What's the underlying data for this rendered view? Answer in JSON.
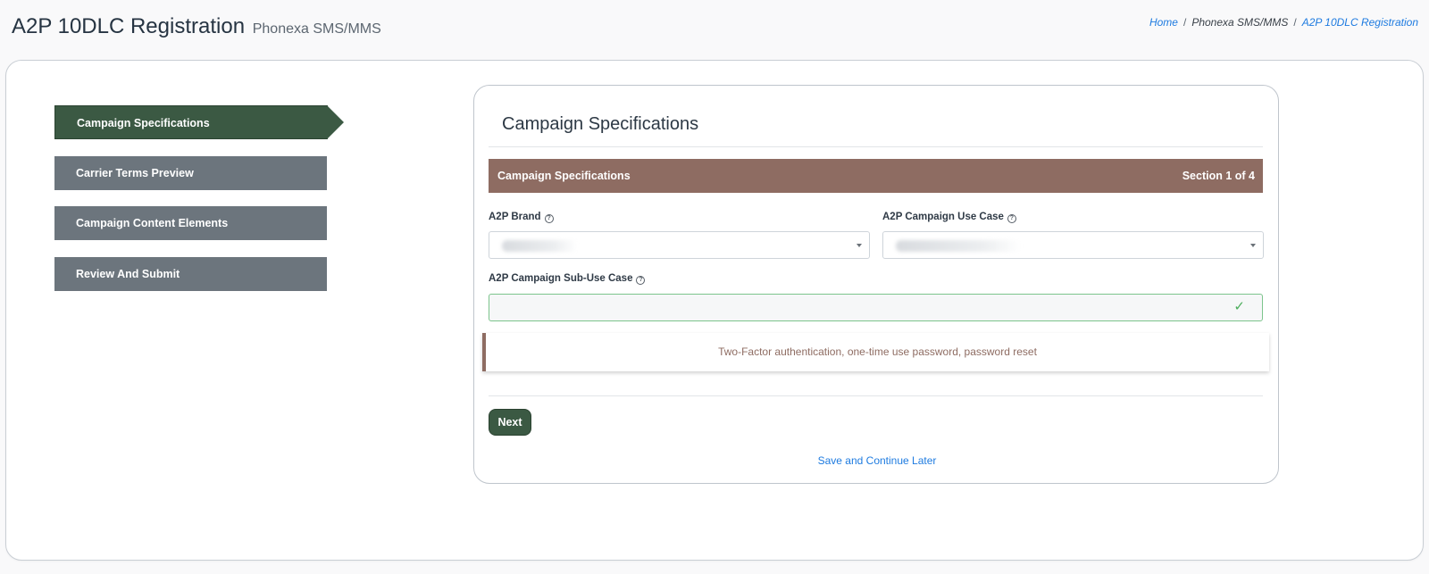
{
  "header": {
    "title": "A2P 10DLC Registration",
    "subtitle": "Phonexa SMS/MMS"
  },
  "breadcrumb": {
    "items": [
      "Home",
      "Phonexa SMS/MMS",
      "A2P 10DLC Registration"
    ],
    "separator": "/"
  },
  "steps": [
    {
      "label": "Campaign Specifications",
      "active": true
    },
    {
      "label": "Carrier Terms Preview",
      "active": false
    },
    {
      "label": "Campaign Content Elements",
      "active": false
    },
    {
      "label": "Review And Submit",
      "active": false
    }
  ],
  "form": {
    "title": "Campaign Specifications",
    "section": {
      "name": "Campaign Specifications",
      "progress": "Section 1 of 4"
    },
    "fields": {
      "brand_label": "A2P Brand",
      "use_case_label": "A2P Campaign Use Case",
      "sub_use_case_label": "A2P Campaign Sub-Use Case",
      "help_glyph": "?",
      "valid_glyph": "✓"
    },
    "use_case_description": "Two-Factor authentication, one-time use password, password reset",
    "next_label": "Next",
    "save_later_label": "Save and Continue Later"
  },
  "colors": {
    "active_step": "#3b5943",
    "inactive_step": "#6c757d",
    "section_bar": "#8e6c62",
    "link": "#1e7be0",
    "valid": "#4cae5c"
  },
  "icons": [
    "help-icon",
    "chevron-down-icon",
    "checkmark-icon",
    "step-arrow-icon"
  ]
}
